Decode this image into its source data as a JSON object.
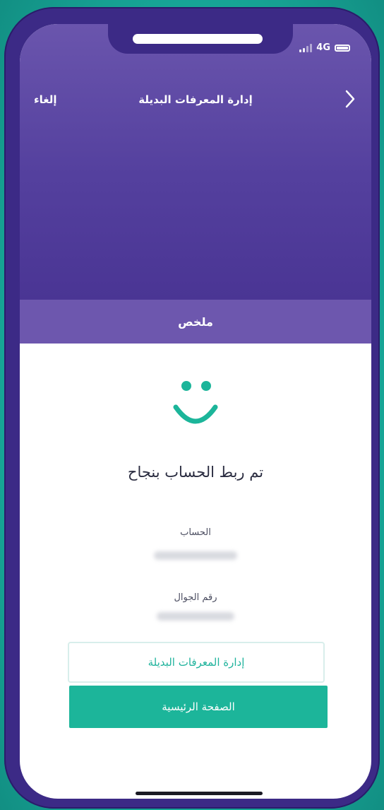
{
  "status_bar": {
    "network": "4G"
  },
  "nav": {
    "title": "إدارة المعرفات البديلة",
    "cancel_label": "إلغاء",
    "back_icon": "chevron-right-icon"
  },
  "summary": {
    "label": "ملخص"
  },
  "result": {
    "icon": "smiley-icon",
    "title": "تم ربط الحساب بنجاح",
    "account_label": "الحساب",
    "phone_label": "رقم الجوال"
  },
  "actions": {
    "manage_label": "إدارة المعرفات البديلة",
    "home_label": "الصفحة الرئيسية"
  },
  "colors": {
    "background_teal": "#1fb4a4",
    "header_purple": "#54409e",
    "summary_purple": "#6d57ae",
    "accent_green": "#1cb59a"
  }
}
